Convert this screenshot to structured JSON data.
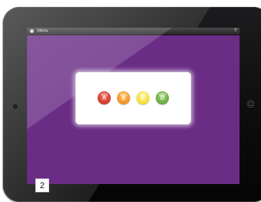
{
  "topbar": {
    "menu_label": "Menu",
    "help_label": "?",
    "menu_icon": "menu-circle-icon",
    "help_icon": "question-mark-icon"
  },
  "options": [
    {
      "label": "A",
      "color": "#d1362a"
    },
    {
      "label": "B",
      "color": "#f39322"
    },
    {
      "label": "C",
      "color": "#f3dc2d"
    },
    {
      "label": "D",
      "color": "#68a840"
    }
  ],
  "screen_color": "#6a2d86",
  "page_label": "2"
}
